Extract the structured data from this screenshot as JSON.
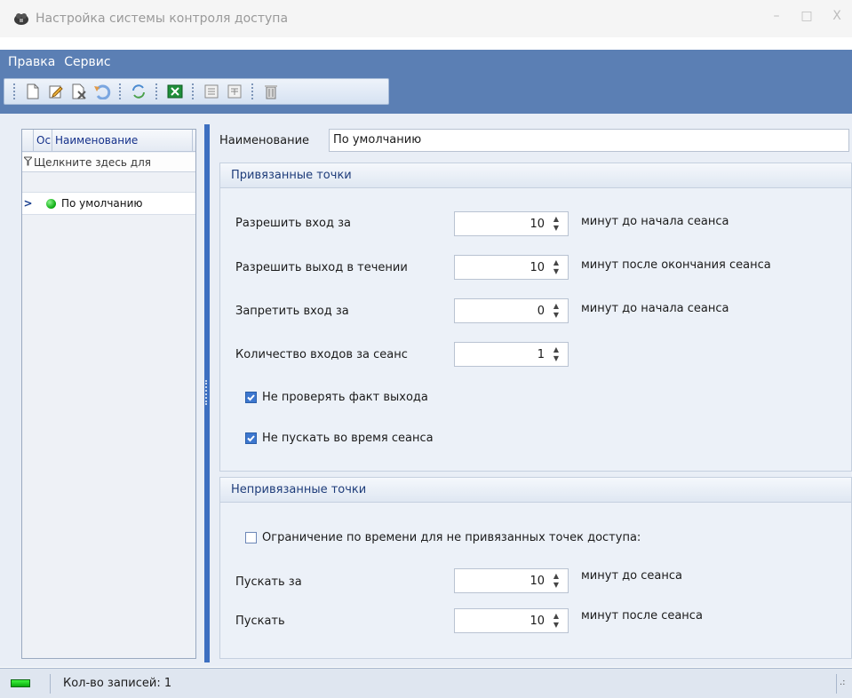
{
  "window": {
    "title": "Настройка системы контроля доступа",
    "minimize": "–",
    "maximize": "□",
    "close": "X"
  },
  "menu": {
    "items": [
      "Правка",
      "Сервис"
    ]
  },
  "toolbar": {
    "buttons": [
      "new-icon",
      "edit-icon",
      "delete-icon",
      "undo-icon",
      "refresh-icon",
      "excel-export-icon",
      "collapse-icon",
      "expand-icon",
      "trash-icon"
    ]
  },
  "grid": {
    "columns": [
      "Ос",
      "Наименование"
    ],
    "filter_placeholder": "Щелкните здесь для",
    "rows": [
      {
        "status": "green",
        "name": "По умолчанию"
      }
    ]
  },
  "form": {
    "name_label": "Наименование",
    "name_value": "По умолчанию",
    "bound": {
      "title": "Привязанные точки",
      "allow_entry_label": "Разрешить вход за",
      "allow_entry_value": "10",
      "allow_entry_suffix": "минут до начала сеанса",
      "allow_exit_label": "Разрешить выход в течении",
      "allow_exit_value": "10",
      "allow_exit_suffix": "минут после окончания сеанса",
      "deny_entry_label": "Запретить вход за",
      "deny_entry_value": "0",
      "deny_entry_suffix": "минут до начала сеанса",
      "entries_label": "Количество входов за сеанс",
      "entries_value": "1",
      "no_exit_check_label": "Не проверять факт выхода",
      "no_exit_check_checked": true,
      "block_during_label": "Не пускать во время сеанса",
      "block_during_checked": true
    },
    "unbound": {
      "title": "Непривязанные точки",
      "time_limit_label": "Ограничение по времени для не привязанных точек доступа:",
      "time_limit_checked": false,
      "allow_before_label": "Пускать за",
      "allow_before_value": "10",
      "allow_before_suffix": "минут до сеанса",
      "allow_after_label": "Пускать",
      "allow_after_value": "10",
      "allow_after_suffix": "минут после сеанса"
    }
  },
  "status": {
    "records_label": "Кол-во записей: 1"
  },
  "colors": {
    "menubar": "#5b7fb4",
    "splitter": "#3d6fc0",
    "status_ok": "#0fae14"
  }
}
